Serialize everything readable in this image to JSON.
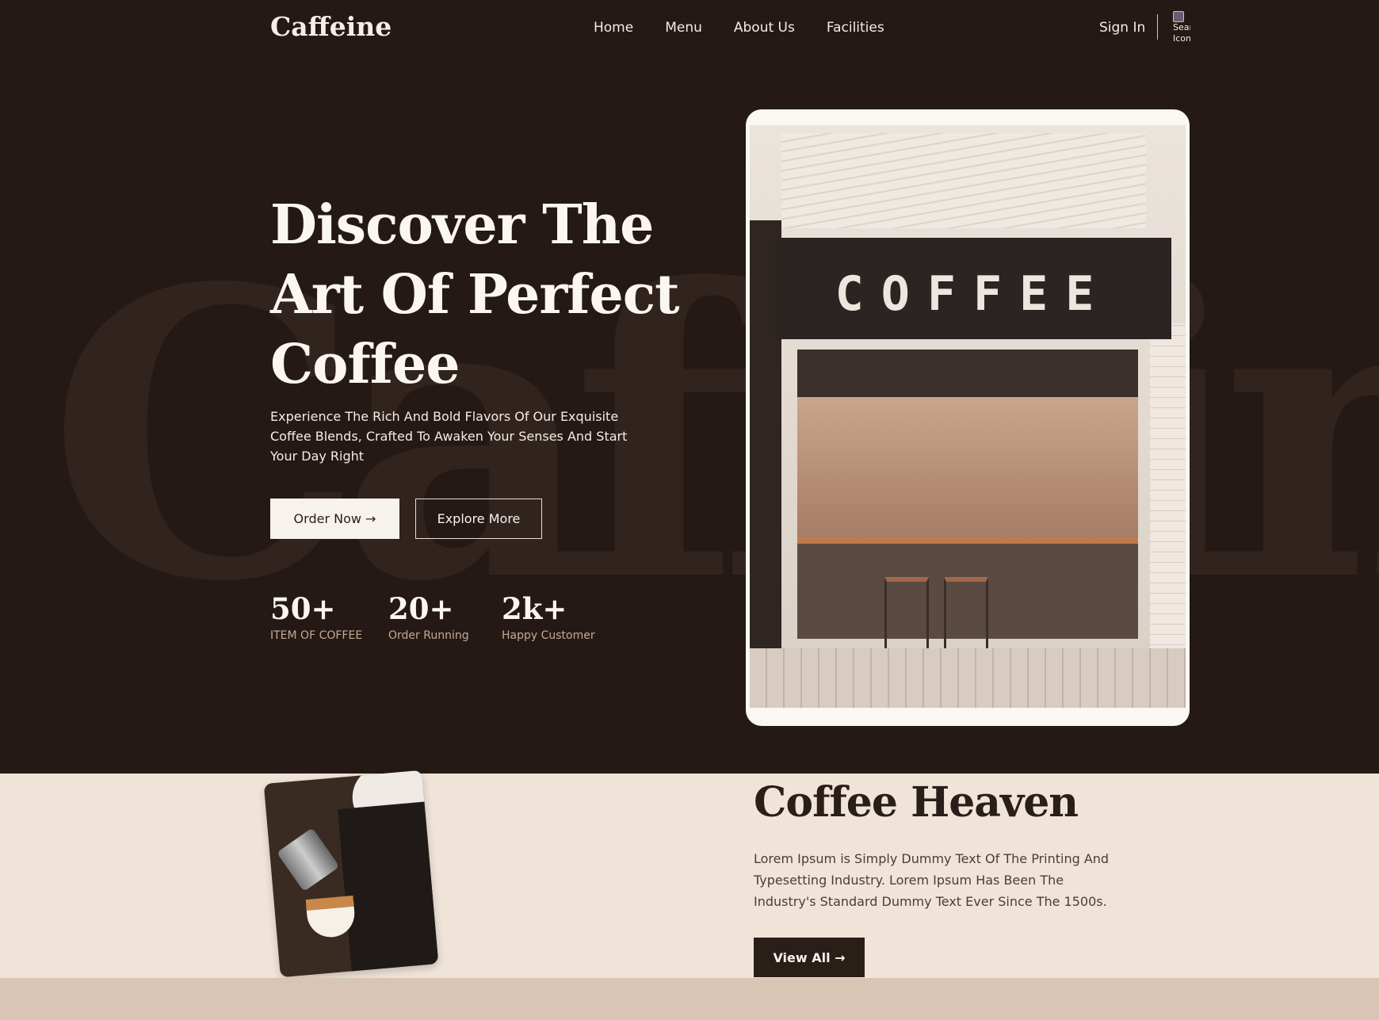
{
  "brand": {
    "logo": "Caffeine",
    "watermark": "Caffeine"
  },
  "nav": {
    "items": [
      {
        "label": "Home"
      },
      {
        "label": "Menu"
      },
      {
        "label": "About Us"
      },
      {
        "label": "Facilities"
      }
    ],
    "sign_in": "Sign In",
    "search_icon_alt": "Search Icon"
  },
  "hero": {
    "headline": "Discover The Art Of Perfect Coffee",
    "description": "Experience The Rich And Bold Flavors Of Our Exquisite Coffee Blends, Crafted To Awaken Your Senses And Start Your Day Right",
    "order_button": "Order Now →",
    "explore_button": "Explore More",
    "stats": [
      {
        "value": "50+",
        "label": "ITEM OF COFFEE"
      },
      {
        "value": "20+",
        "label": "Order Running"
      },
      {
        "value": "2k+",
        "label": "Happy Customer"
      }
    ],
    "shop_sign": "COFFEE"
  },
  "about": {
    "title": "Coffee Heaven",
    "description": "Lorem Ipsum is Simply Dummy Text Of The Printing And Typesetting Industry. Lorem Ipsum Has Been The Industry's Standard Dummy Text Ever Since The 1500s.",
    "view_all_button": "View All →"
  },
  "colors": {
    "hero_bg": "#241915",
    "about_bg": "#f0e4d8",
    "footer_band": "#d8c5b3",
    "accent_dark": "#2a1e19",
    "stat_label": "#c4aa95"
  }
}
